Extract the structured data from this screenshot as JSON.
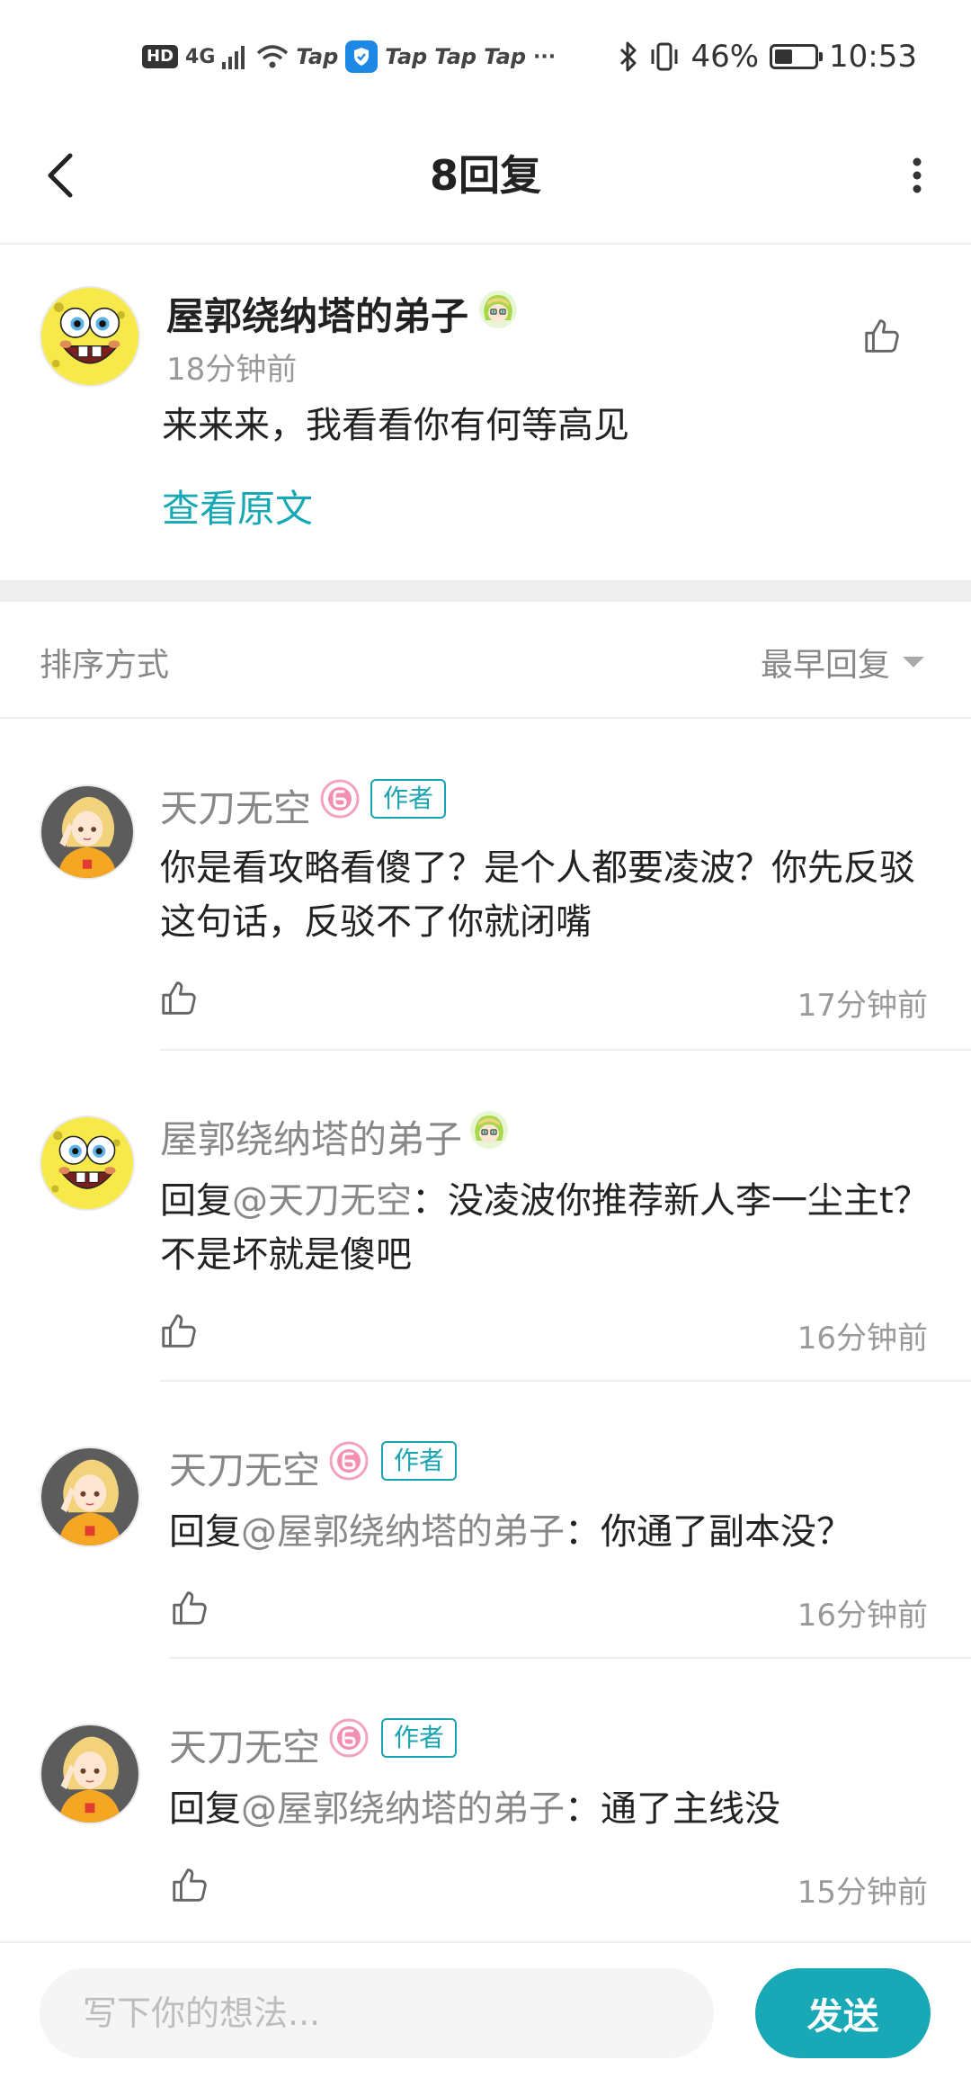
{
  "status_bar": {
    "hd": "HD",
    "network": "4G",
    "apps": [
      "Tap",
      "Tap",
      "Tap",
      "Tap"
    ],
    "more": "···",
    "battery_percent": "46%",
    "battery_level": 0.46,
    "time": "10:53"
  },
  "header": {
    "title": "8回复"
  },
  "main_post": {
    "username": "屋郭绕纳塔的弟子",
    "time": "18分钟前",
    "content": "来来来，我看看你有何等高见",
    "view_original": "查看原文"
  },
  "sort": {
    "label": "排序方式",
    "selected": "最早回复"
  },
  "replies": [
    {
      "username": "天刀无空",
      "badge": "作者",
      "content": "你是看攻略看傻了？是个人都要凌波？你先反驳这句话，反驳不了你就闭嘴",
      "time": "17分钟前"
    },
    {
      "username": "屋郭绕纳塔的弟子",
      "mention_prefix": "回复",
      "mention": "@天刀无空",
      "content": "：没凌波你推荐新人李一尘主t？不是坏就是傻吧",
      "time": "16分钟前"
    },
    {
      "username": "天刀无空",
      "badge": "作者",
      "mention_prefix": "回复",
      "mention": "@屋郭绕纳塔的弟子",
      "content": "：你通了副本没？",
      "time": "16分钟前"
    },
    {
      "username": "天刀无空",
      "badge": "作者",
      "mention_prefix": "回复",
      "mention": "@屋郭绕纳塔的弟子",
      "content": "：通了主线没",
      "time": "15分钟前"
    }
  ],
  "composer": {
    "placeholder": "写下你的想法...",
    "send_label": "发送"
  },
  "colors": {
    "accent": "#19a9b6",
    "muted": "#888888",
    "divider": "#eeeeee"
  }
}
